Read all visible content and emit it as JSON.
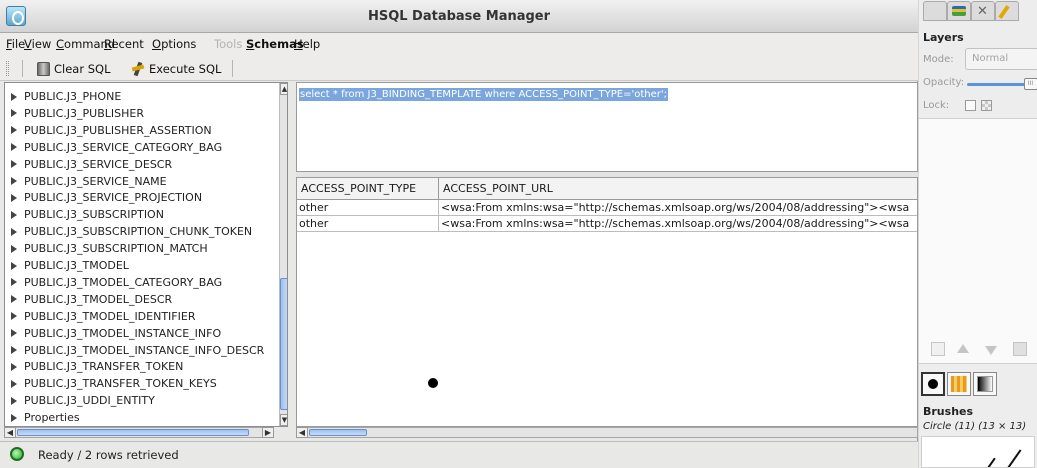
{
  "window": {
    "title": "HSQL Database Manager"
  },
  "menu": [
    {
      "prefix": "",
      "mnemonic": "F",
      "rest": "ile",
      "disabled": false,
      "bold": false
    },
    {
      "prefix": "",
      "mnemonic": "V",
      "rest": "iew",
      "disabled": false,
      "bold": false
    },
    {
      "prefix": "",
      "mnemonic": "C",
      "rest": "ommand",
      "disabled": false,
      "bold": false
    },
    {
      "prefix": "",
      "mnemonic": "R",
      "rest": "ecent",
      "disabled": false,
      "bold": false
    },
    {
      "prefix": "",
      "mnemonic": "O",
      "rest": "ptions",
      "disabled": false,
      "bold": false
    },
    {
      "prefix": "",
      "mnemonic": "",
      "rest": "Tools",
      "disabled": true,
      "bold": false
    },
    {
      "prefix": "",
      "mnemonic": "S",
      "rest": "chemas",
      "disabled": false,
      "bold": true
    },
    {
      "prefix": "",
      "mnemonic": "H",
      "rest": "elp",
      "disabled": false,
      "bold": false
    }
  ],
  "toolbar": {
    "clear_label": "Clear SQL",
    "execute_label": "Execute SQL"
  },
  "tree": {
    "items": [
      "PUBLIC.J3_PHONE",
      "PUBLIC.J3_PUBLISHER",
      "PUBLIC.J3_PUBLISHER_ASSERTION",
      "PUBLIC.J3_SERVICE_CATEGORY_BAG",
      "PUBLIC.J3_SERVICE_DESCR",
      "PUBLIC.J3_SERVICE_NAME",
      "PUBLIC.J3_SERVICE_PROJECTION",
      "PUBLIC.J3_SUBSCRIPTION",
      "PUBLIC.J3_SUBSCRIPTION_CHUNK_TOKEN",
      "PUBLIC.J3_SUBSCRIPTION_MATCH",
      "PUBLIC.J3_TMODEL",
      "PUBLIC.J3_TMODEL_CATEGORY_BAG",
      "PUBLIC.J3_TMODEL_DESCR",
      "PUBLIC.J3_TMODEL_IDENTIFIER",
      "PUBLIC.J3_TMODEL_INSTANCE_INFO",
      "PUBLIC.J3_TMODEL_INSTANCE_INFO_DESCR",
      "PUBLIC.J3_TRANSFER_TOKEN",
      "PUBLIC.J3_TRANSFER_TOKEN_KEYS",
      "PUBLIC.J3_UDDI_ENTITY",
      "Properties"
    ]
  },
  "editor": {
    "sql": "select * from J3_BINDING_TEMPLATE where ACCESS_POINT_TYPE='other';"
  },
  "results": {
    "columns": [
      "ACCESS_POINT_TYPE",
      "ACCESS_POINT_URL"
    ],
    "rows": [
      [
        "other",
        "<wsa:From xmlns:wsa=\"http://schemas.xmlsoap.org/ws/2004/08/addressing\"><wsa"
      ],
      [
        "other",
        "<wsa:From xmlns:wsa=\"http://schemas.xmlsoap.org/ws/2004/08/addressing\"><wsa"
      ]
    ]
  },
  "status": {
    "message": "Ready / 2 rows retrieved",
    "indicator_color": "#1fb31f"
  },
  "gimp": {
    "layers_title": "Layers",
    "mode_label": "Mode:",
    "mode_value": "Normal",
    "opacity_label": "Opacity:",
    "opacity_fraction": 0.95,
    "lock_label": "Lock:",
    "brushes_title": "Brushes",
    "brush_name": "Circle (11) (13 × 13)"
  }
}
